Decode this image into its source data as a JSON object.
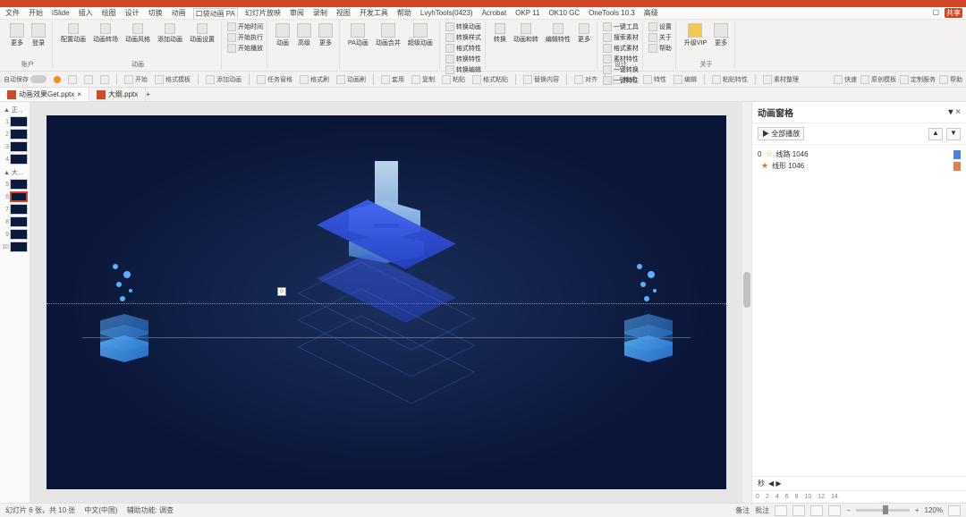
{
  "menu": {
    "items": [
      "文件",
      "开始",
      "iSlide",
      "插入",
      "绘图",
      "设计",
      "切换",
      "动画",
      "口袋动画 PA",
      "幻灯片放映",
      "审阅",
      "录制",
      "视图",
      "开发工具",
      "帮助",
      "LvyhTools(0423)",
      "Acrobat",
      "OKP 11",
      "OK10 GC",
      "OneTools 10.3",
      "高级"
    ],
    "active": "口袋动画 PA",
    "share": "共享"
  },
  "ribbon": {
    "groups": [
      {
        "label": "账户",
        "btns": [
          {
            "t": "更多"
          },
          {
            "t": "登录"
          }
        ]
      },
      {
        "label": "动画",
        "btns": [
          {
            "t": "配置动画"
          },
          {
            "t": "动画转场"
          },
          {
            "t": "动画风格"
          },
          {
            "t": "添加动画"
          },
          {
            "t": "动画设置"
          }
        ]
      },
      {
        "label": "",
        "rows": [
          "开始时间",
          "开始执行",
          "开始播放"
        ]
      },
      {
        "label": "",
        "btns": [
          {
            "t": "动画"
          },
          {
            "t": "高级"
          },
          {
            "t": "更多"
          }
        ]
      },
      {
        "label": "",
        "btns": [
          {
            "t": "PA动画"
          },
          {
            "t": "动画合并"
          },
          {
            "t": "超级动画"
          }
        ]
      },
      {
        "label": "",
        "rows": [
          "转换动画",
          "转换样式",
          "格式特性",
          "转换特性",
          "转换编辑"
        ]
      },
      {
        "label": "",
        "btns": [
          {
            "t": "转换"
          },
          {
            "t": "动画和转"
          },
          {
            "t": "编辑特性"
          },
          {
            "t": "更多"
          }
        ]
      },
      {
        "label": "设计",
        "rows": [
          "一键工具",
          "搜索素材",
          "格式素材",
          "素材特性",
          "一键转换",
          "一键特性"
        ]
      },
      {
        "label": "",
        "rows": [
          "设置",
          "关于",
          "帮助"
        ]
      },
      {
        "label": "关于",
        "btns": [
          {
            "t": "升级VIP"
          },
          {
            "t": "更多"
          }
        ]
      }
    ]
  },
  "toolbar2": {
    "left_label": "自动保存",
    "items": [
      "保存",
      "撤销",
      "重做",
      "开始",
      "格式模板",
      "添加动画",
      "任务窗格",
      "格式刷",
      "动画刷",
      "套用",
      "复制",
      "粘贴",
      "格式粘贴",
      "替换内容",
      "对齐",
      "格式",
      "特性",
      "编辑",
      "粘贴特性",
      "素材整理"
    ],
    "right": [
      "快速",
      "原创模板",
      "定制服务",
      "帮助"
    ]
  },
  "doctabs": {
    "tabs": [
      {
        "label": "动画效果Get.pptx",
        "active": true
      },
      {
        "label": "大纲.pptx",
        "active": false
      }
    ]
  },
  "thumbs": {
    "sections": [
      "▲ 正...",
      "▲ 大..."
    ],
    "slides": [
      1,
      2,
      3,
      4,
      5,
      6,
      7,
      8,
      9,
      10
    ],
    "selected": 6
  },
  "slide": {
    "marker": "◇"
  },
  "anim": {
    "title": "动画窗格",
    "play": "▶ 全部播放",
    "items": [
      {
        "num": "0",
        "star": "☆",
        "label": "线路 1046",
        "color": "blue"
      },
      {
        "num": "",
        "star": "★",
        "label": "线形 1046",
        "color": "org"
      }
    ],
    "ruler": [
      0,
      2,
      4,
      6,
      8,
      10,
      12,
      14
    ],
    "foot": "秒"
  },
  "status": {
    "left": [
      "幻灯片 6 张，共 10 张",
      "中文(中国)",
      "辅助功能: 调查"
    ],
    "notes": "备注",
    "comments": "批注",
    "zoom": "120%"
  }
}
